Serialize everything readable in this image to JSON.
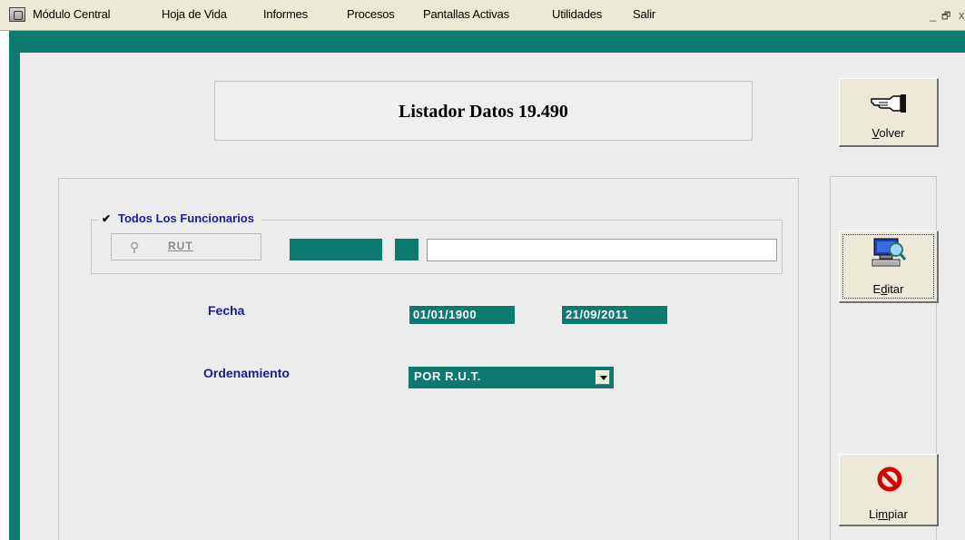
{
  "menu": {
    "items": [
      "Módulo Central",
      "Hoja de Vida",
      "Informes",
      "Procesos",
      "Pantallas Activas",
      "Utilidades",
      "Salir"
    ]
  },
  "window_controls": {
    "minimize": "_",
    "restore": "🗗",
    "close": "x"
  },
  "title": "Listador Datos 19.490",
  "buttons": {
    "volver": {
      "pre": "",
      "u": "V",
      "post": "olver",
      "icon": "pointing-hand-icon"
    },
    "editar": {
      "pre": "E",
      "u": "d",
      "post": "itar",
      "icon": "computer-magnifier-icon"
    },
    "limpiar": {
      "pre": "Li",
      "u": "m",
      "post": "piar",
      "icon": "no-sign-icon"
    }
  },
  "filter": {
    "checkbox_label": "Todos Los Funcionarios",
    "checkbox_checked": true,
    "rut_button_label": "RUT",
    "rut_value": "",
    "name_value": ""
  },
  "fecha": {
    "label": "Fecha",
    "from": "01/01/1900",
    "to": "21/09/2011"
  },
  "ordenamiento": {
    "label": "Ordenamiento",
    "selected": "POR R.U.T."
  },
  "colors": {
    "teal": "#0d7a70",
    "label_blue": "#1a1aa0",
    "face": "#ececec"
  }
}
